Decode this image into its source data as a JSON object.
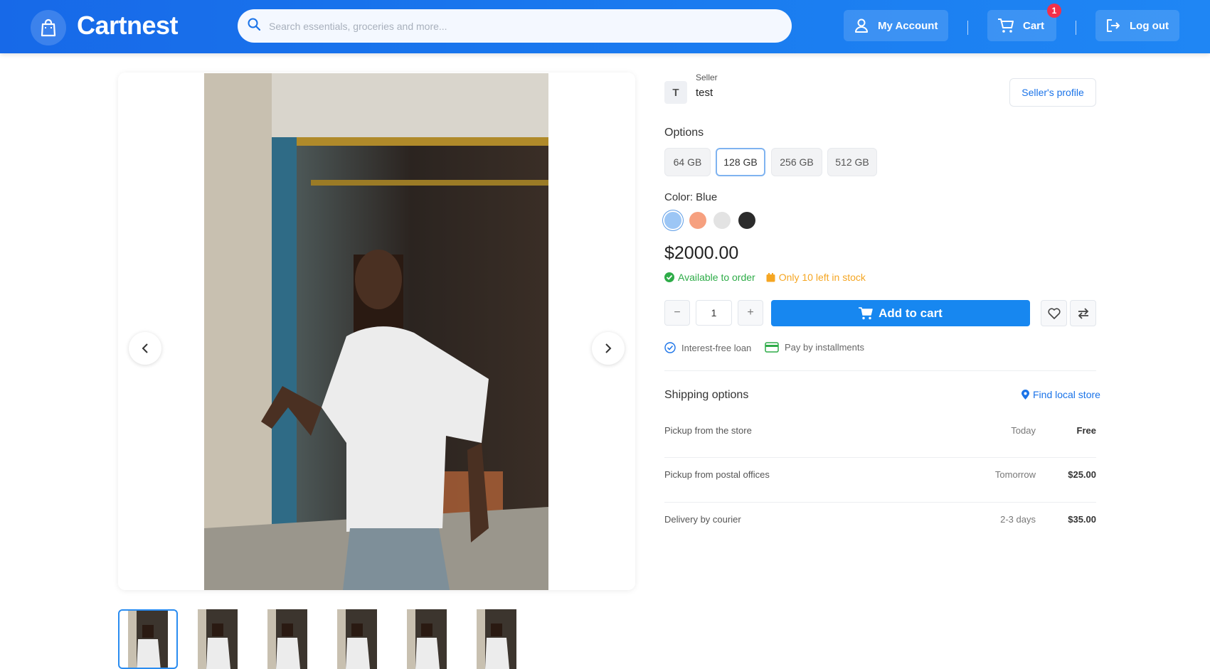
{
  "brand": {
    "name": "Cartnest"
  },
  "search": {
    "placeholder": "Search essentials, groceries and more..."
  },
  "header": {
    "account_label": "My Account",
    "cart_label": "Cart",
    "cart_count": "1",
    "logout_label": "Log out"
  },
  "seller": {
    "initial": "T",
    "caption": "Seller",
    "name": "test",
    "profile_button": "Seller's profile"
  },
  "options": {
    "label": "Options",
    "items": [
      "64 GB",
      "128 GB",
      "256 GB",
      "512 GB"
    ],
    "selected": "128 GB"
  },
  "color": {
    "label": "Color: Blue",
    "swatches": [
      "#9cc6f5",
      "#f6a07f",
      "#e3e3e3",
      "#2b2b2b"
    ],
    "selected": "#9cc6f5"
  },
  "price": "$2000.00",
  "stock": {
    "availability": "Available to order",
    "availability_color": "#2eac48",
    "low_stock": "Only 10 left in stock",
    "low_stock_color": "#f5a623"
  },
  "quantity": {
    "minus": "−",
    "value": "1",
    "plus": "+"
  },
  "add_to_cart": "Add to cart",
  "perks": {
    "loan": "Interest-free loan",
    "installments": "Pay by installments"
  },
  "shipping": {
    "title": "Shipping options",
    "find_store": "Find local store",
    "rows": [
      {
        "name": "Pickup from the store",
        "when": "Today",
        "price": "Free"
      },
      {
        "name": "Pickup from postal offices",
        "when": "Tomorrow",
        "price": "$25.00"
      },
      {
        "name": "Delivery by courier",
        "when": "2-3 days",
        "price": "$35.00"
      }
    ]
  },
  "accent_color": "#1787f0"
}
